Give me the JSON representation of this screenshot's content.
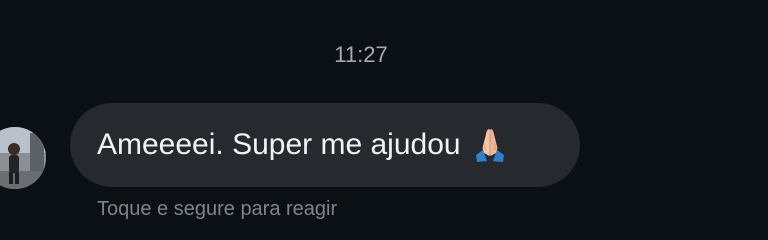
{
  "conversation": {
    "timestamp": "11:27",
    "message": {
      "text": "Ameeeei. Super me ajudou",
      "emoji": "folded-hands-icon"
    },
    "hint": "Toque e segure para reagir"
  },
  "colors": {
    "background": "#0b1014",
    "bubble": "#262a2e",
    "message_text": "#f1f2f3",
    "timestamp_text": "#a6aaae",
    "hint_text": "#7f8489"
  }
}
